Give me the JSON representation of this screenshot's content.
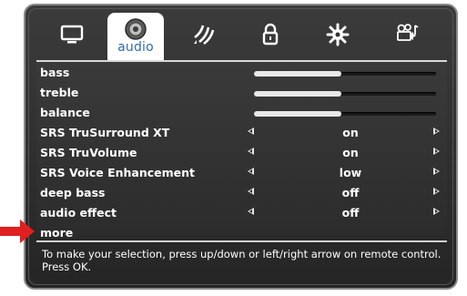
{
  "tabs": [
    {
      "id": "picture",
      "label": "",
      "icon": "tv-icon"
    },
    {
      "id": "audio",
      "label": "audio",
      "icon": "speaker-icon",
      "active": true
    },
    {
      "id": "network",
      "label": "",
      "icon": "wireless-icon"
    },
    {
      "id": "lock",
      "label": "",
      "icon": "lock-icon"
    },
    {
      "id": "settings",
      "label": "",
      "icon": "gear-icon"
    },
    {
      "id": "media",
      "label": "",
      "icon": "media-icon"
    }
  ],
  "menu": {
    "rows": [
      {
        "label": "bass",
        "type": "slider",
        "level": 0.48
      },
      {
        "label": "treble",
        "type": "slider",
        "level": 0.48
      },
      {
        "label": "balance",
        "type": "slider",
        "level": 0.48
      },
      {
        "label": "SRS TruSurround XT",
        "type": "option",
        "value": "on"
      },
      {
        "label": "SRS TruVolume",
        "type": "option",
        "value": "on"
      },
      {
        "label": "SRS Voice Enhancement",
        "type": "option",
        "value": "low"
      },
      {
        "label": "deep bass",
        "type": "option",
        "value": "off"
      },
      {
        "label": "audio effect",
        "type": "option",
        "value": "off"
      },
      {
        "label": "more",
        "type": "link"
      }
    ]
  },
  "help": {
    "text": "To make your selection, press up/down or left/right arrow on remote control. Press OK."
  },
  "colors": {
    "accent": "#2f6db5",
    "pointer": "#e02020",
    "panel": "#333333"
  }
}
